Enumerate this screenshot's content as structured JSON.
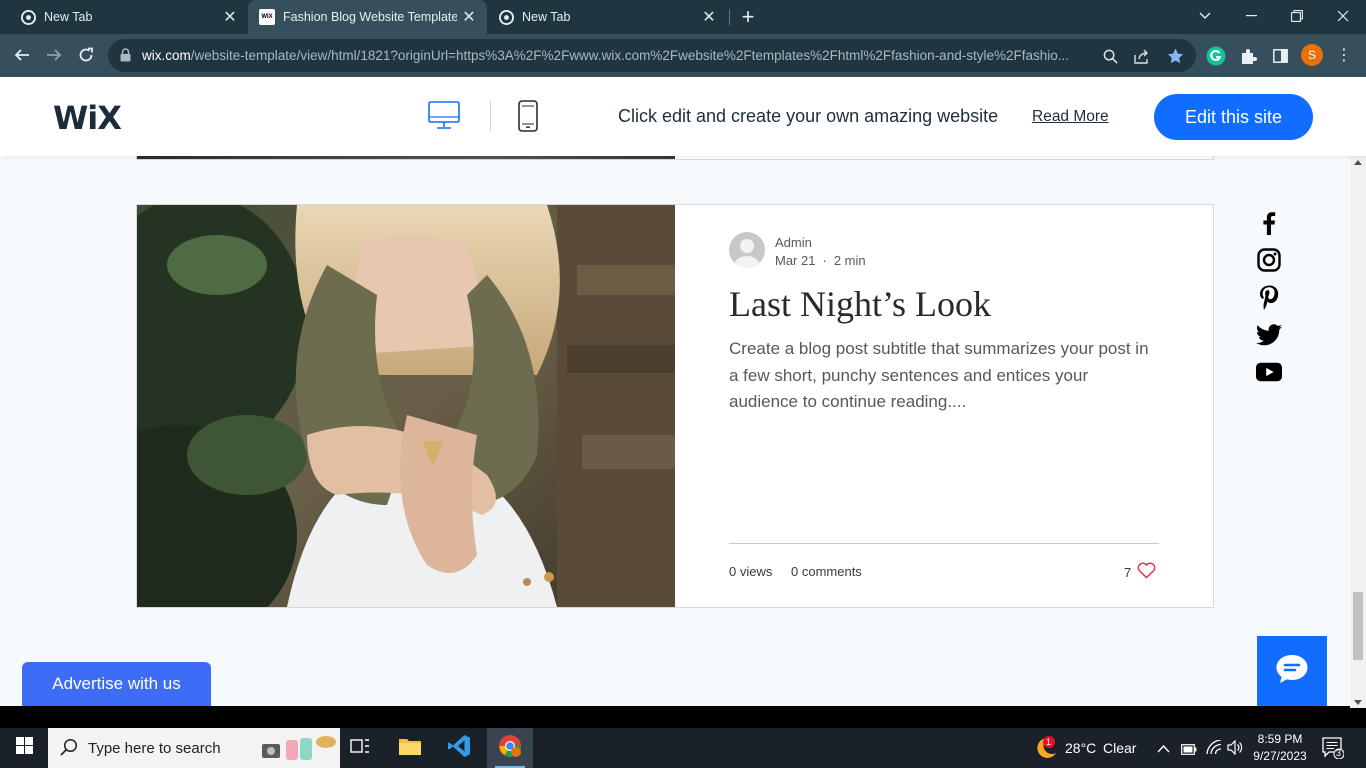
{
  "browser": {
    "tabs": [
      {
        "title": "New Tab",
        "icon": "chrome-icon",
        "active": false
      },
      {
        "title": "Fashion Blog Website Template |",
        "icon": "wix-favicon",
        "active": true
      },
      {
        "title": "New Tab",
        "icon": "chrome-icon",
        "active": false
      }
    ],
    "url_domain": "wix.com",
    "url_path": "/website-template/view/html/1821?originUrl=https%3A%2F%2Fwww.wix.com%2Fwebsite%2Ftemplates%2Fhtml%2Ffashion-and-style%2Ffashio...",
    "profile_initial": "S",
    "favicon_text": "WIX"
  },
  "wix_banner": {
    "logo": "WiX",
    "promo_text": "Click edit and create your own amazing website",
    "read_more": "Read More",
    "edit_button": "Edit this site"
  },
  "post": {
    "author": "Admin",
    "date": "Mar 21",
    "dot": "·",
    "read_time": "2 min",
    "title": "Last Night’s Look",
    "excerpt": "Create a blog post subtitle that summarizes your post in a few short, punchy sentences and entices your audience to continue reading....",
    "views": "0 views",
    "comments": "0 comments",
    "likes": "7"
  },
  "social": [
    "facebook-icon",
    "instagram-icon",
    "pinterest-icon",
    "twitter-icon",
    "youtube-icon"
  ],
  "advertise": "Advertise with us",
  "taskbar": {
    "search_placeholder": "Type here to search",
    "weather_badge": "1",
    "temperature": "28°C",
    "condition": "Clear",
    "time": "8:59 PM",
    "date": "9/27/2023",
    "notification_count": "3"
  },
  "colors": {
    "wix_blue": "#116dff",
    "advertise_blue": "#3d6cf5",
    "heart": "#e03c4c",
    "chrome_frame": "#1f3540",
    "chrome_toolbar": "#35505c"
  }
}
